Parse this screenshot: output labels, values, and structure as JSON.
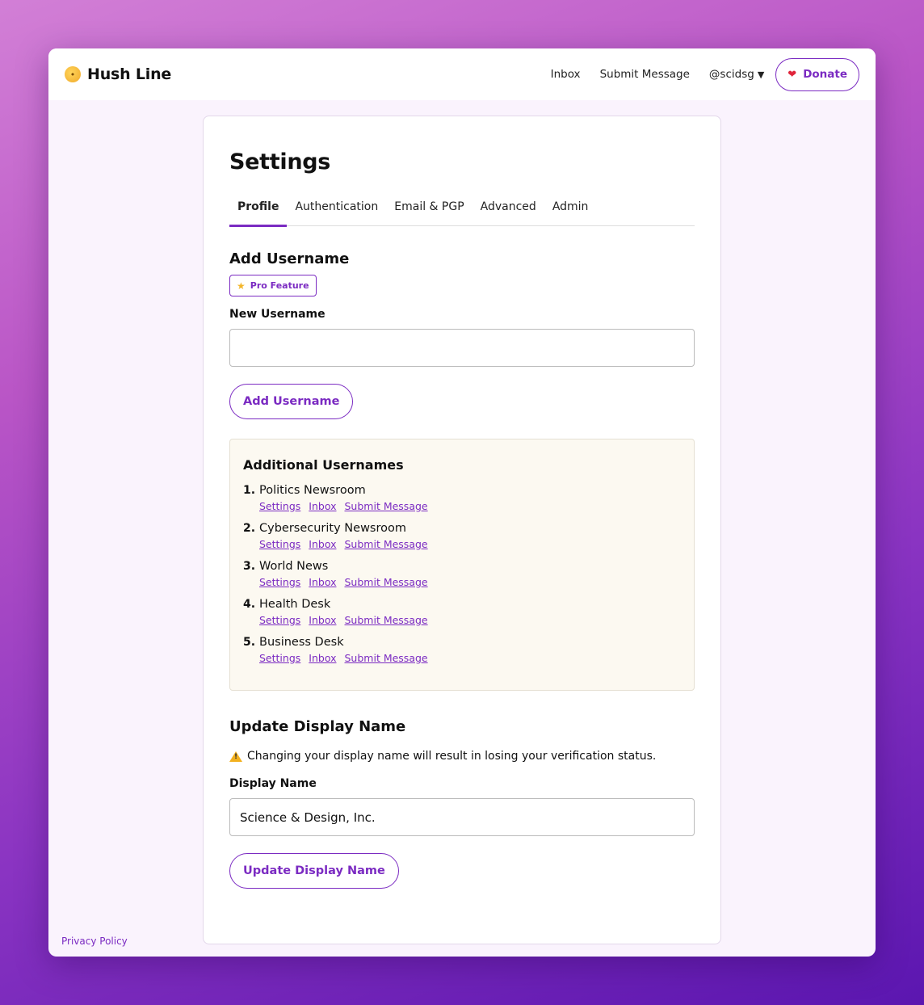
{
  "app": {
    "title": "Hush Line",
    "brand_icon": "shushing-face-icon",
    "accent_color": "#7b2bc2"
  },
  "nav": {
    "inbox": "Inbox",
    "submit_message": "Submit Message",
    "user": "@scidsg",
    "donate": "Donate"
  },
  "page": {
    "title": "Settings",
    "tabs": [
      "Profile",
      "Authentication",
      "Email & PGP",
      "Advanced",
      "Admin"
    ],
    "active_tab": "Profile"
  },
  "add_username": {
    "heading": "Add Username",
    "badge": "Pro Feature",
    "field_label": "New Username",
    "field_value": "",
    "button": "Add Username"
  },
  "additional_usernames": {
    "heading": "Additional Usernames",
    "items": [
      {
        "num": "1.",
        "name": "Politics Newsroom",
        "links": [
          "Settings",
          "Inbox",
          "Submit Message"
        ]
      },
      {
        "num": "2.",
        "name": "Cybersecurity Newsroom",
        "links": [
          "Settings",
          "Inbox",
          "Submit Message"
        ]
      },
      {
        "num": "3.",
        "name": "World News",
        "links": [
          "Settings",
          "Inbox",
          "Submit Message"
        ]
      },
      {
        "num": "4.",
        "name": "Health Desk",
        "links": [
          "Settings",
          "Inbox",
          "Submit Message"
        ]
      },
      {
        "num": "5.",
        "name": "Business Desk",
        "links": [
          "Settings",
          "Inbox",
          "Submit Message"
        ]
      }
    ]
  },
  "display_name": {
    "heading": "Update Display Name",
    "warning": "Changing your display name will result in losing your verification status.",
    "field_label": "Display Name",
    "field_value": "Science & Design, Inc.",
    "button": "Update Display Name"
  },
  "footer": {
    "privacy": "Privacy Policy"
  }
}
